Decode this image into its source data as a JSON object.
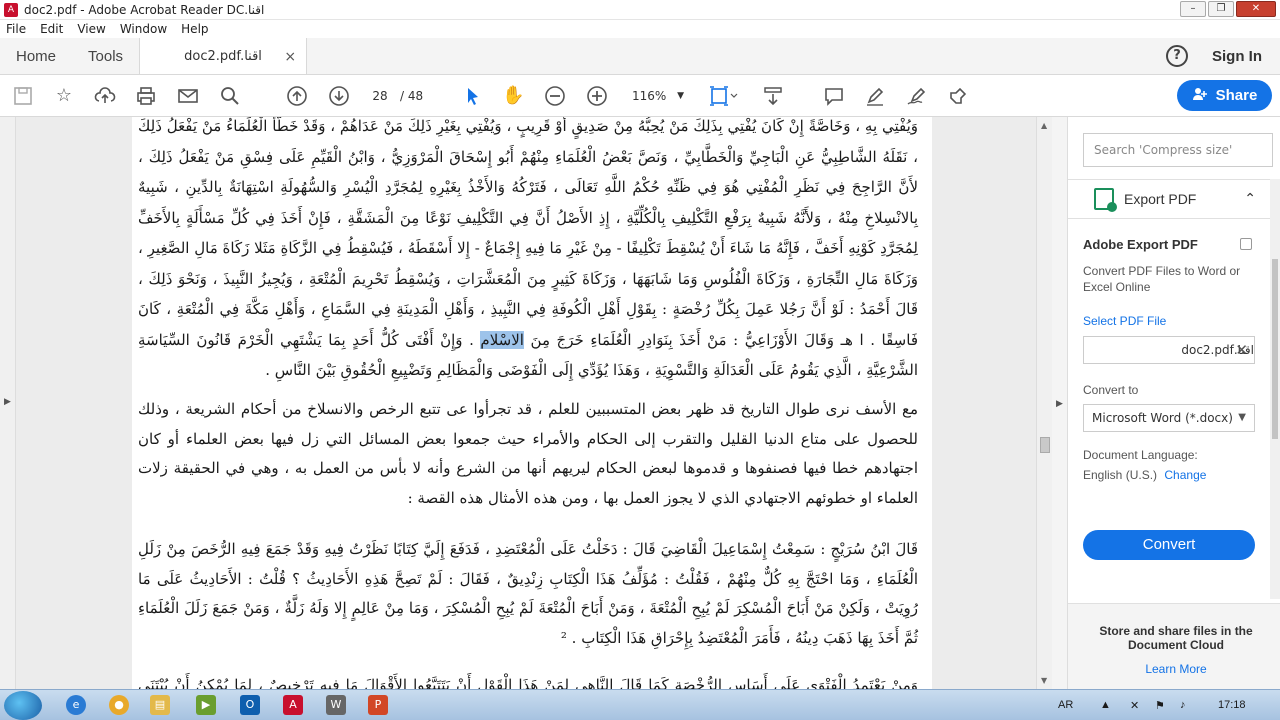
{
  "window": {
    "title": "اقنا.doc2.pdf - Adobe Acrobat Reader DC",
    "controls": [
      "–",
      "❐",
      "✕"
    ]
  },
  "menu": [
    "File",
    "Edit",
    "View",
    "Window",
    "Help"
  ],
  "tabs": {
    "home": "Home",
    "tools": "Tools",
    "doc": "doc2.pdf.اقنا",
    "close": "×",
    "help": "?",
    "signin": "Sign In"
  },
  "toolbar": {
    "page_current": "28",
    "page_total": "/  48",
    "zoom": "116%",
    "share": "Share"
  },
  "document": {
    "para1": "وَيُفْتِي بِهِ ، وَخَاصَّةً إِنْ كَانَ يُفْتِي بِذَلِكَ مَنْ يُحِبُّهُ مِنْ صَدِيقٍ أَوْ قَرِيبٍ ، وَيُفْتِي بِغَيْرِ ذَلِكَ مَنْ عَدَاهُمْ ، وَقَدْ خَطَّأَ الْعُلَمَاءُ مَنْ يَفْعَلُ ذَلِكَ ، نَقَلَهُ الشَّاطِبِيُّ عَنِ الْبَاجِيِّ وَالْخَطَّابِيِّ ، وَنَصَّ بَعْضُ الْعُلَمَاءِ مِنْهُمْ أَبُو إِسْحَاقَ الْمَرْوَزِيُّ ، وَابْنُ الْقَيِّمِ عَلَى فِسْقِ مَنْ يَفْعَلُ ذَلِكَ ، لأَنَّ الرَّاجِحَ فِي نَظَرِ الْمُفْتِي هُوَ فِي ظَنِّهِ حُكْمُ اللَّهِ تَعَالَى ، فَتَرْكُهُ وَالأَخْذُ بِغَيْرِهِ لِمُجَرَّدِ الْيُسْرِ وَالسُّهُولَةِ اسْتِهَانَةٌ بِالدِّينِ ، شَبِيهٌ بِالانْسِلاخِ مِنْهُ ، وَلأَنَّهُ شَبِيهٌ بِرَفْعِ التَّكْلِيفِ بِالْكُلِّيَّةِ ، إِذِ الأَصْلُ أَنَّ فِي التَّكْلِيفِ نَوْعًا مِنَ الْمَشَقَّةِ ، فَإِنْ أَخَذَ فِي كُلِّ مَسْأَلَةٍ بِالأَخَفِّ لِمُجَرَّدِ كَوْنِهِ أَخَفَّ ، فَإِنَّهُ مَا شَاءَ أَنْ يُسْقِطَ تَكْلِيفًا - مِنْ غَيْرِ مَا فِيهِ إِجْمَاعٌ - إِلا أَسْقَطَهُ ، فَيُسْقِطُ فِي الزَّكَاةِ مَثَلا زَكَاةَ مَالِ الصَّغِيرِ ، وَزَكَاةَ مَالِ التِّجَارَةِ ، وَزَكَاةَ الْفُلُوسِ وَمَا شَابَهَهَا ، وَزَكَاةَ كَثِيرٍ مِنَ الْمُعَشَّرَاتِ ، وَيُسْقِطُ تَحْرِيمَ الْمُتْعَةِ ، وَيُجِيزُ النَّبِيذَ ، وَنَحْوَ ذَلِكَ ، قَالَ أَحْمَدُ : لَوْ أَنَّ رَجُلا عَمِلَ بِكُلِّ رُخْصَةٍ : بِقَوْلِ أَهْلِ الْكُوفَةِ فِي النَّبِيذِ ، وَأَهْلِ الْمَدِينَةِ فِي السَّمَاعِ ، وَأَهْلِ مَكَّةَ فِي الْمُتْعَةِ ، كَانَ فَاسِقًا . ا هـ وَقَالَ الأَوْزَاعِيُّ : مَنْ أَخَذَ بِنَوَادِرِ الْعُلَمَاءِ خَرَجَ مِنَ",
    "para1_hl": "الاسْلام",
    "para1_tail": " . وَإِنْ أَفْتَى كُلُّ أَحَدٍ بِمَا يَشْتَهِي الْخَرْمَ قَانُونَ السِّيَاسَةِ الشَّرْعِيَّةِ ، الَّذِي يَقُومُ عَلَى الْعَدَالَةِ وَالتَّسْوِيَةِ ، وَهَذَا يُؤَدِّي إِلَى الْفَوْضَى وَالْمَظَالِمِ وَتَضْيِيعِ الْحُقُوقِ بَيْنَ النَّاسِ .",
    "para2": "مع الأسف نرى طوال التاريخ قد ظهر بعض المتسببين للعلم ، قد تجرأوا عى تتبع الرخص والانسلاخ من أحكام الشريعة ، وذلك للحصول على متاع الدنيا القليل والتقرب إلى الحكام والأمراء حيث جمعوا بعض المسائل التي زل فيها بعض العلماء أو كان اجتهادهم خطا فيها فصنفوها و قدموها لبعض الحكام ليريهم أنها من الشرع وأنه لا بأس من العمل به ، وهي في الحقيقة زلات العلماء او خطوئهم الاجتهادي الذي لا يجوز العمل بها ، ومن هذه الأمثال هذه القصة :",
    "para3": "قَالَ ابْنُ سُرَيْجٍ : سَمِعْتُ إِسْمَاعِيلَ الْقَاضِيَ قَالَ : دَخَلْتُ عَلَى الْمُعْتَضِدِ ، فَدَفَعَ إِلَيَّ كِتَابًا نَظَرْتُ فِيهِ وَقَدْ جَمَعَ فِيهِ الرُّخَصَ مِنْ زَلَلِ الْعُلَمَاءِ ، وَمَا احْتَجَّ بِهِ كُلٌّ مِنْهُمْ ، فَقُلْتُ : مُؤَلِّفُ هَذَا الْكِتَابِ زِنْدِيقٌ ، فَقَالَ : لَمْ تَصِحَّ هَذِهِ الأَحَادِيثُ ؟ قُلْتُ : الأَحَادِيثُ عَلَى مَا رُوِيَتْ ، وَلَكِنْ مَنْ أَبَاحَ الْمُسْكِرَ لَمْ يُبِحِ الْمُتْعَةَ ، وَمَنْ أَبَاحَ الْمُتْعَةَ لَمْ يُبِحِ الْمُسْكِرَ ، وَمَا مِنْ عَالِمٍ إِلا وَلَهُ زَلَّةٌ ، وَمَنْ جَمَعَ زَلَلَ الْعُلَمَاءِ ثُمَّ أَخَذَ بِهَا ذَهَبَ دِينُهُ ، فَأَمَرَ الْمُعْتَضِدُ بِإِحْرَاقِ هَذَا الْكِتَابِ . ²",
    "para4": "وَمِنْ يَعْتَمِدُ الْفَتْوَى عَلَى أَسَاسِ الرُّخْصَةِ كَمَا قَالَ النَّاهِي لِمَنْ هَذَا الْقَوْلِ أَنْ يَتَتَبَّعُوا الأَقْوَالَ مَا فِيهِ تَرْخِيصٌ ، لِمَا يُمْكِنُ أَنْ يُبْتَنَى صَحِيحٌ ، قَالَ ابْنُ"
  },
  "right_pane": {
    "search_placeholder": "Search 'Compress size'",
    "export_title": "Export PDF",
    "heading": "Adobe Export PDF",
    "desc": "Convert PDF Files to Word or Excel Online",
    "select_link": "Select PDF File",
    "file_name": "اقنا.doc2.pdf",
    "convert_to_label": "Convert to",
    "convert_to_value": "Microsoft Word (*.docx)",
    "lang_label": "Document Language:",
    "lang_value": "English (U.S.)",
    "lang_change": "Change",
    "convert_button": "Convert",
    "cloud_title": "Store and share files in the Document Cloud",
    "cloud_link": "Learn More"
  },
  "taskbar": {
    "lang": "AR",
    "time": "17:18"
  },
  "colors": {
    "accent": "#1473e6",
    "highlight": "#9dc3ea",
    "close": "#c7402f"
  }
}
